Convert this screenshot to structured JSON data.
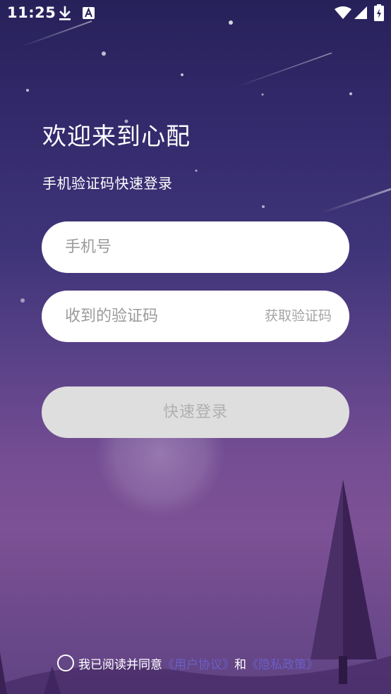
{
  "status_bar": {
    "time": "11:25",
    "icons": [
      "download-icon",
      "text-a-icon",
      "wifi-icon",
      "signal-icon",
      "battery-charging-icon"
    ]
  },
  "login": {
    "title": "欢迎来到心配",
    "subtitle": "手机验证码快速登录",
    "phone_placeholder": "手机号",
    "phone_value": "",
    "code_placeholder": "收到的验证码",
    "code_value": "",
    "get_code_label": "获取验证码",
    "submit_label": "快速登录"
  },
  "agreement": {
    "checked": false,
    "prefix": "我已阅读并同意",
    "user_agreement_label": "《用户协议》",
    "conjunction": "和",
    "privacy_policy_label": "《隐私政策》"
  },
  "colors": {
    "background_top": "#27215a",
    "background_bottom": "#7d5195",
    "input_background": "#ffffff",
    "button_disabled": "#dedede",
    "link": "#6b5fc7"
  }
}
